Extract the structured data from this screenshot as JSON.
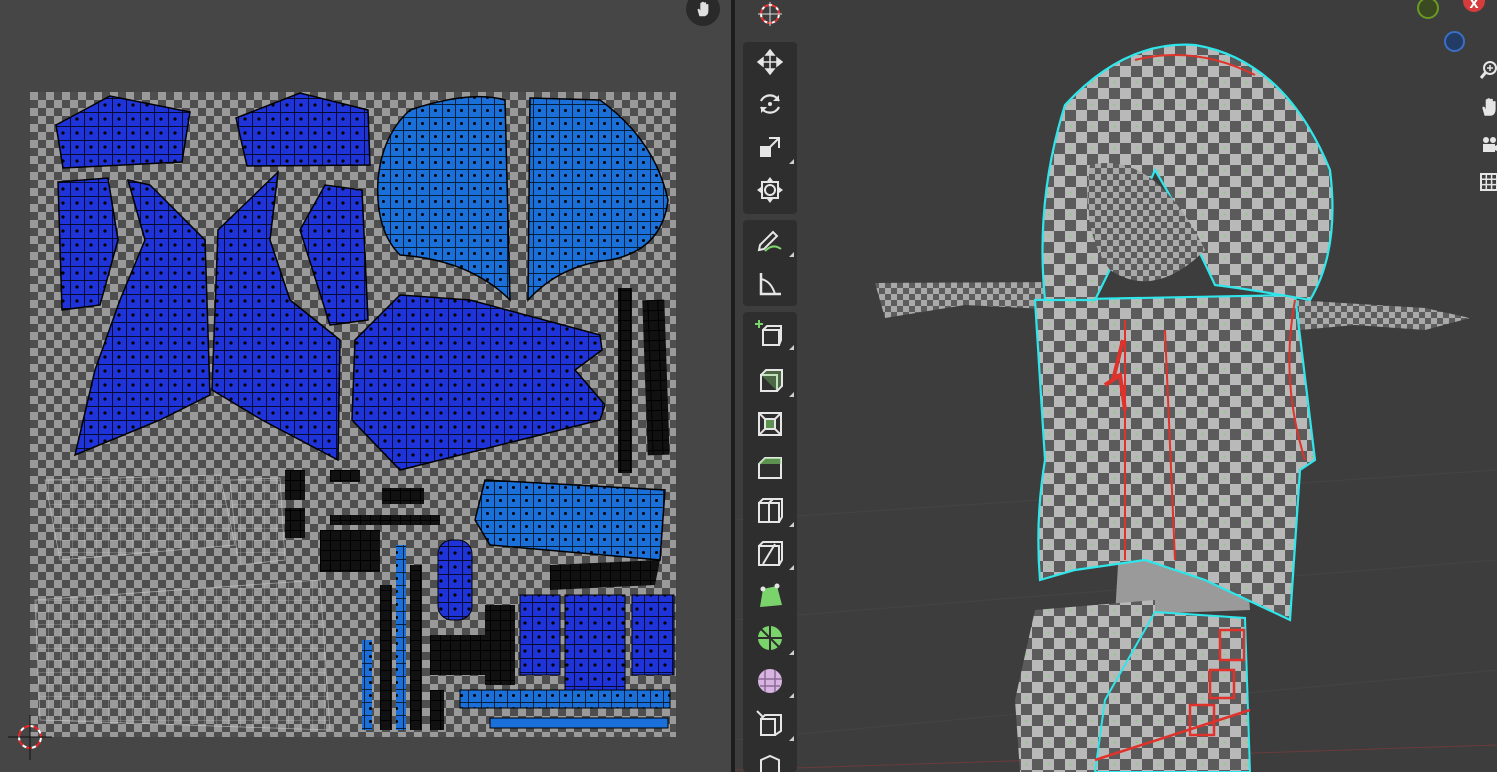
{
  "uv_editor": {
    "pan_icon": "hand-icon",
    "cursor_icon": "uv-2d-cursor-icon",
    "island_color": "#1f34d8",
    "island_color_alt": "#1a6fd8",
    "selected_edge_color": "#000000"
  },
  "viewport": {
    "tools": [
      {
        "name": "cursor-tool",
        "icon": "cursor-icon"
      },
      {
        "name": "move-tool",
        "icon": "move-icon"
      },
      {
        "name": "rotate-tool",
        "icon": "rotate-icon"
      },
      {
        "name": "scale-tool",
        "icon": "scale-icon"
      },
      {
        "name": "transform-tool",
        "icon": "transform-icon"
      },
      {
        "name": "annotate-tool",
        "icon": "annotate-icon"
      },
      {
        "name": "measure-tool",
        "icon": "measure-icon"
      },
      {
        "name": "add-cube-tool",
        "icon": "add-cube-icon"
      },
      {
        "name": "extrude-tool",
        "icon": "extrude-icon"
      },
      {
        "name": "inset-tool",
        "icon": "inset-icon"
      },
      {
        "name": "bevel-tool",
        "icon": "bevel-icon"
      },
      {
        "name": "loop-cut-tool",
        "icon": "loop-cut-icon"
      },
      {
        "name": "knife-tool",
        "icon": "knife-icon"
      },
      {
        "name": "poly-build-tool",
        "icon": "poly-build-icon"
      },
      {
        "name": "spin-tool",
        "icon": "spin-icon"
      },
      {
        "name": "smooth-tool",
        "icon": "smooth-icon"
      },
      {
        "name": "shear-tool",
        "icon": "shear-icon"
      },
      {
        "name": "rip-tool",
        "icon": "rip-icon"
      }
    ],
    "gizmo": {
      "y_axis_color": "#6a9a24",
      "x_axis_color": "#d63c3c",
      "z_axis_color": "#3b6fc4",
      "x_label": "X"
    },
    "navigation": [
      "zoom-icon",
      "pan-hand-icon",
      "camera-icon",
      "grid-icon"
    ],
    "seam_color": "#e0322a",
    "selected_edge_color": "#2fe6ea"
  }
}
